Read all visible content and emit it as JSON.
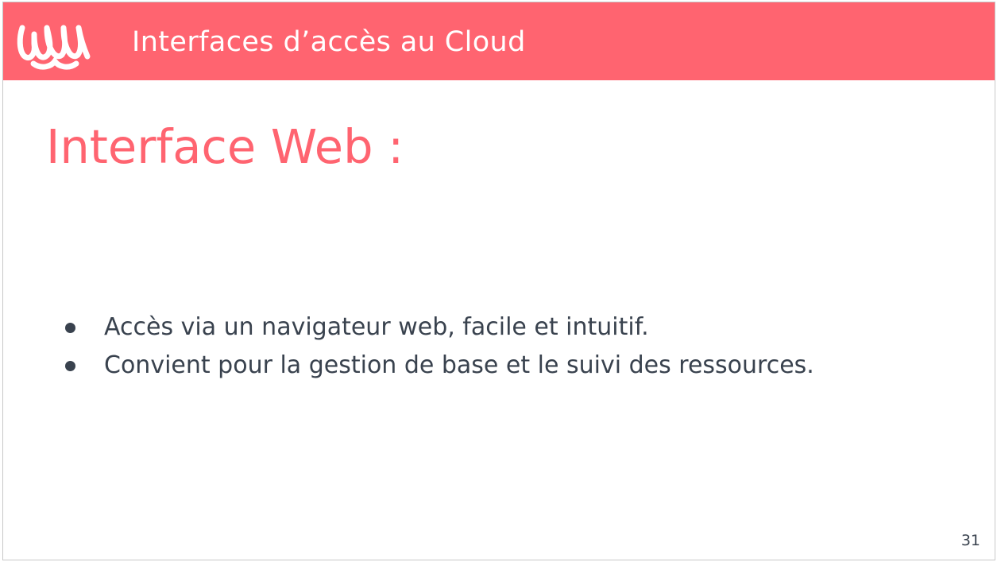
{
  "header": {
    "logo_icon": "wave-loops-logo-icon",
    "title": "Interfaces d’accès au Cloud"
  },
  "slide": {
    "title": "Interface Web :",
    "bullets": [
      "Accès via un navigateur web, facile et intuitif.",
      "Convient pour la gestion de base et le suivi des ressources."
    ],
    "page_number": "31"
  },
  "colors": {
    "accent": "#ff6470",
    "text": "#39424e",
    "background": "#ffffff"
  }
}
